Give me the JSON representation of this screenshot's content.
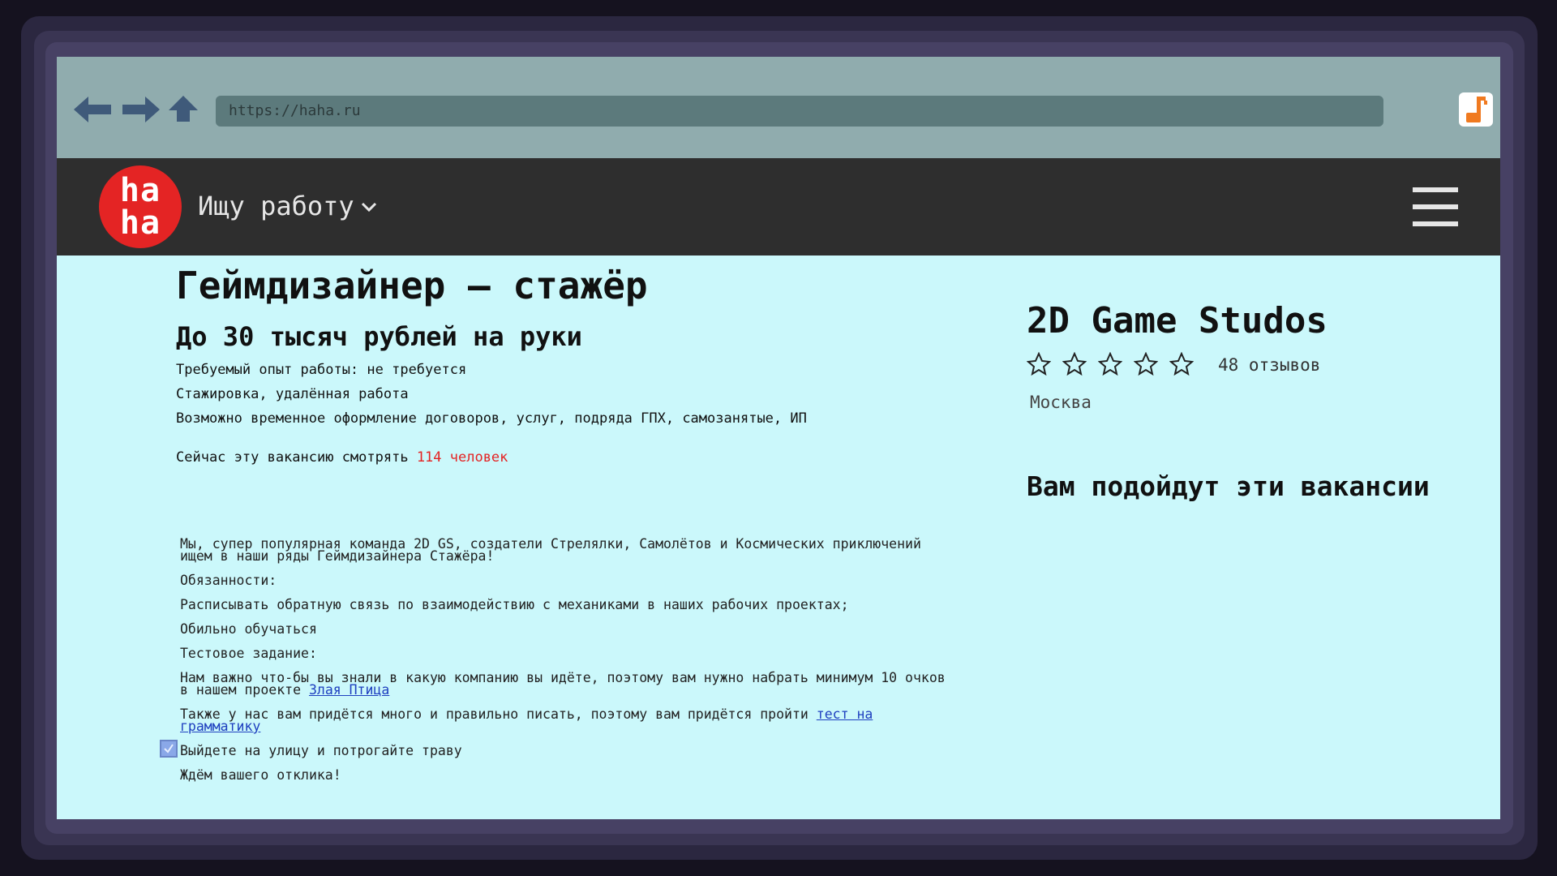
{
  "browser": {
    "url": "https://haha.ru"
  },
  "header": {
    "logo_top": "ha",
    "logo_bottom": "ha",
    "job_seek": "Ищу работу"
  },
  "vacancy": {
    "title": "Геймдизайнер – стажёр",
    "salary": "До 30 тысяч рублей на руки",
    "conditions": [
      "Требуемый опыт работы: не требуется",
      "Стажировка, удалённая работа",
      "Возможно временное оформление договоров, услуг, подряда ГПХ, самозанятые, ИП"
    ],
    "viewers_prefix": "Сейчас эту вакансию смотрять ",
    "viewers_count": "114 человек"
  },
  "description": {
    "intro_line1": "Мы, супер популярная команда 2D GS, создатели Стрелялки, Самолётов и Космических приключений",
    "intro_line2": "ищем в наши ряды Геймдизайнера Стажёра!",
    "duties_heading": "Обязанности:",
    "duty1": "Расписывать обратную связь по взаимодействию с механиками в наших рабочих проектах;",
    "duty2": "Обильно обучаться",
    "test_heading": "Тестовое задание:",
    "test1_line1": "Нам важно что-бы вы знали в какую компанию вы идёте, поэтому вам нужно набрать минимум 10 очков",
    "test1_line2_prefix": "в нашем проекте ",
    "test1_link": "Злая Птица",
    "test2_line1_prefix": "Также у нас вам придётся много и правильно писать, поэтому вам придётся пройти ",
    "test2_link_part1": "тест на",
    "test2_link_part2": "грамматику",
    "task3": "Выйдете на улицу и потрогайте траву",
    "closing": "Ждём вашего отклика!"
  },
  "company": {
    "name": "2D Game Studos",
    "rating": 0,
    "rating_max": 5,
    "reviews": "48 отзывов",
    "city": "Москва",
    "recommend_heading": "Вам подойдут эти вакансии"
  },
  "colors": {
    "accent_red": "#e42424",
    "page_bg": "#cbf8fb",
    "header_bg": "#2e2e2e",
    "browser_bar": "#90acae"
  }
}
